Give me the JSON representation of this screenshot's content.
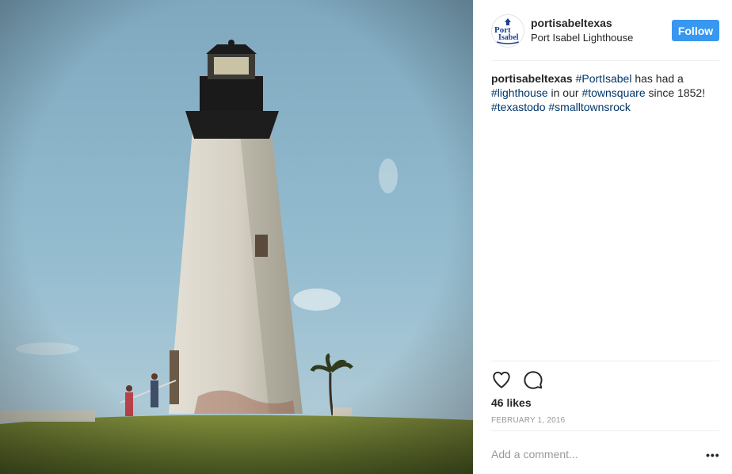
{
  "post": {
    "username": "portisabeltexas",
    "location": "Port Isabel Lighthouse",
    "follow_label": "Follow",
    "caption": {
      "author": "portisabeltexas",
      "parts": [
        {
          "text": " ",
          "tag": false
        },
        {
          "text": "#PortIsabel",
          "tag": true
        },
        {
          "text": " has had a ",
          "tag": false
        },
        {
          "text": "#lighthouse",
          "tag": true
        },
        {
          "text": " in our ",
          "tag": false
        },
        {
          "text": "#townsquare",
          "tag": true
        },
        {
          "text": " since 1852! ",
          "tag": false
        },
        {
          "text": "#texastodo",
          "tag": true
        },
        {
          "text": " ",
          "tag": false
        },
        {
          "text": "#smalltownsrock",
          "tag": true
        }
      ]
    },
    "likes": "46 likes",
    "date": "FEBRUARY 1, 2016",
    "comment_placeholder": "Add a comment...",
    "more_label": "•••",
    "avatar_logo": {
      "line1": "Port",
      "line2": "Isabel"
    }
  },
  "icons": {
    "like": "heart-icon",
    "comment": "comment-icon",
    "more": "ellipsis-icon"
  },
  "colors": {
    "follow": "#3897f0",
    "hashtag": "#003569",
    "text": "#262626",
    "muted": "#999999",
    "logo": "#1c3f94"
  }
}
